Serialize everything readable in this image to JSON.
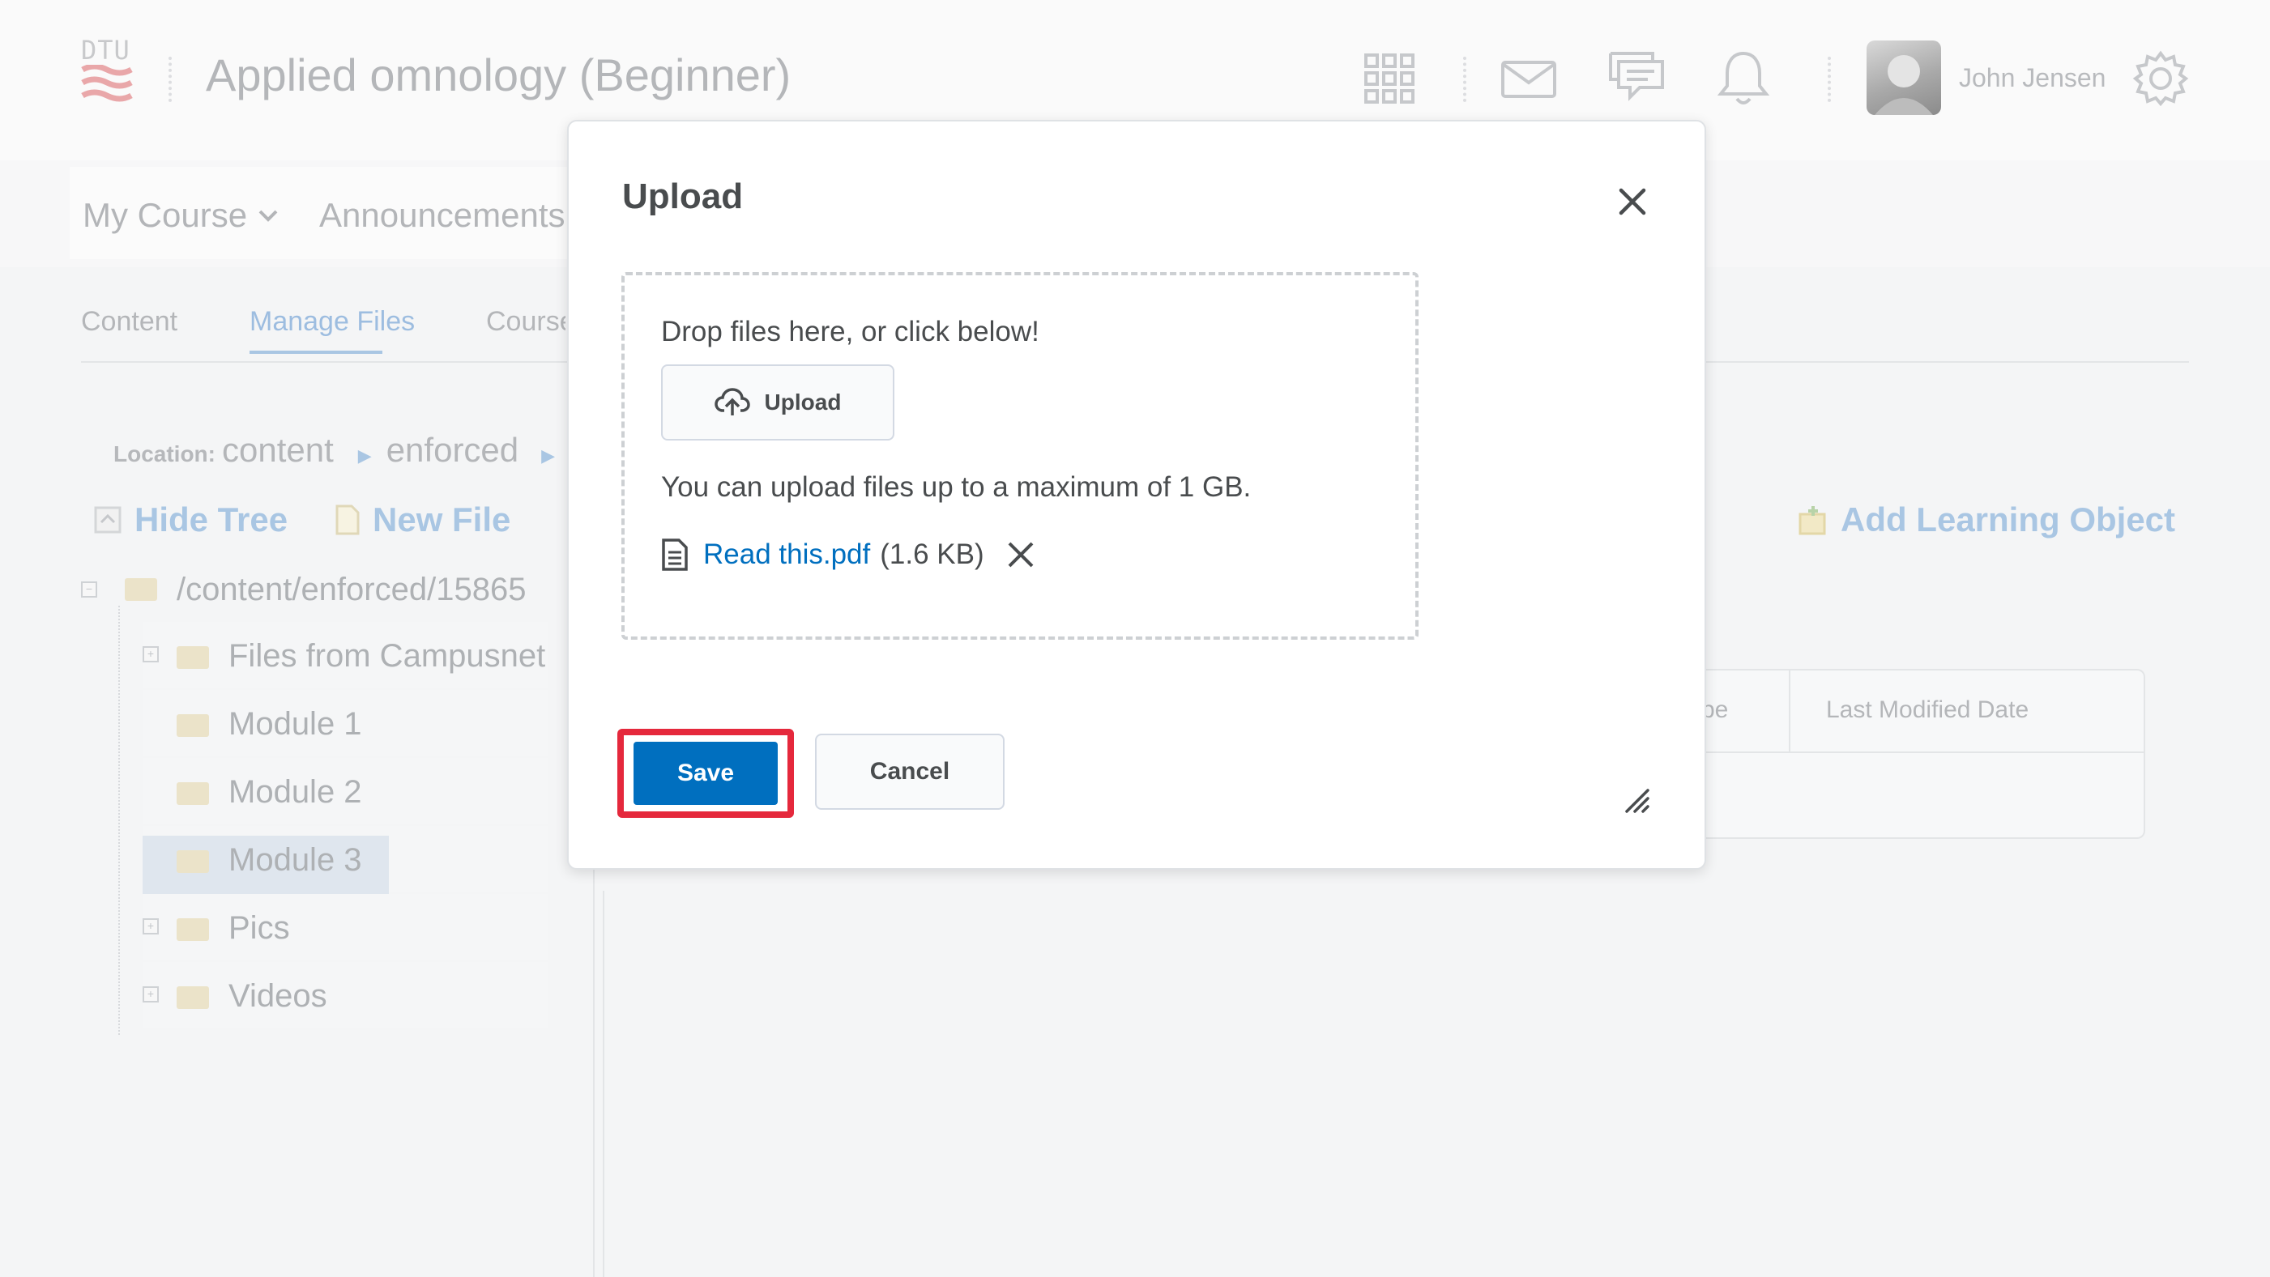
{
  "header": {
    "logo_text": "DTU",
    "course_title": "Applied omnology (Beginner)",
    "user_name": "John Jensen",
    "icons": [
      "apps-grid-icon",
      "mail-icon",
      "chat-icon",
      "bell-icon",
      "gear-icon"
    ]
  },
  "nav": {
    "items": [
      {
        "label": "My Course"
      },
      {
        "label": "Announcements"
      }
    ]
  },
  "tabs": [
    {
      "label": "Content"
    },
    {
      "label": "Manage Files"
    },
    {
      "label": "Course"
    }
  ],
  "location": {
    "prefix": "Location:",
    "crumbs": [
      "content",
      "enforced"
    ]
  },
  "toolbar": {
    "hide_tree": "Hide Tree",
    "new_file": "New File",
    "add_learning_object": "Add Learning Object"
  },
  "tree": {
    "root": "/content/enforced/15865",
    "folders": [
      {
        "label": "Files from Campusnet",
        "expandable": true,
        "selected": false
      },
      {
        "label": "Module 1",
        "expandable": false,
        "selected": false
      },
      {
        "label": "Module 2",
        "expandable": false,
        "selected": false
      },
      {
        "label": "Module 3",
        "expandable": false,
        "selected": true
      },
      {
        "label": "Pics",
        "expandable": true,
        "selected": false
      },
      {
        "label": "Videos",
        "expandable": true,
        "selected": false
      }
    ]
  },
  "table": {
    "columns": [
      "pe",
      "Last Modified Date"
    ]
  },
  "dialog": {
    "title": "Upload",
    "drop_hint": "Drop files here, or click below!",
    "upload_button": "Upload",
    "max_size_text": "You can upload files up to a maximum of 1 GB.",
    "file": {
      "name": "Read this.pdf",
      "size": "(1.6 KB)"
    },
    "save_button": "Save",
    "cancel_button": "Cancel"
  },
  "colors": {
    "primary": "#006fbf",
    "highlight": "#e5283c",
    "link": "#006fbf",
    "faded_link": "#a9c6e3"
  }
}
